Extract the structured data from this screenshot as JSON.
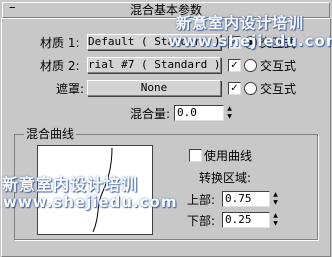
{
  "rollout": {
    "collapse_glyph": "–",
    "title": "混合基本参数"
  },
  "material1": {
    "label": "材质 1:",
    "button": "Default  ( Standard )",
    "checked": "✓",
    "interactive_label": "交互式"
  },
  "material2": {
    "label": "材质 2:",
    "button": "rial #7  ( Standard )",
    "checked": "✓",
    "interactive_label": "交互式"
  },
  "mask": {
    "label": "遮罩:",
    "button": "None",
    "checked": "✓",
    "interactive_label": "交互式"
  },
  "mix_amount": {
    "label": "混合量:",
    "value": "0.0"
  },
  "curve_group": {
    "title": "混合曲线",
    "use_curve_label": "使用曲线",
    "transition_label": "转换区域:",
    "upper": {
      "label": "上部:",
      "value": "0.75"
    },
    "lower": {
      "label": "下部:",
      "value": "0.25"
    }
  },
  "watermarks": {
    "line1_top": "新意室内设计培训",
    "line2_top": "www.shejiedu.com",
    "line1_bottom": "新意室内设计培训",
    "line2_bottom": "www.shejiedu.com"
  },
  "colors": {
    "panel_bg": "#c8c8c8",
    "watermark_glow": "#4a6fb5"
  }
}
